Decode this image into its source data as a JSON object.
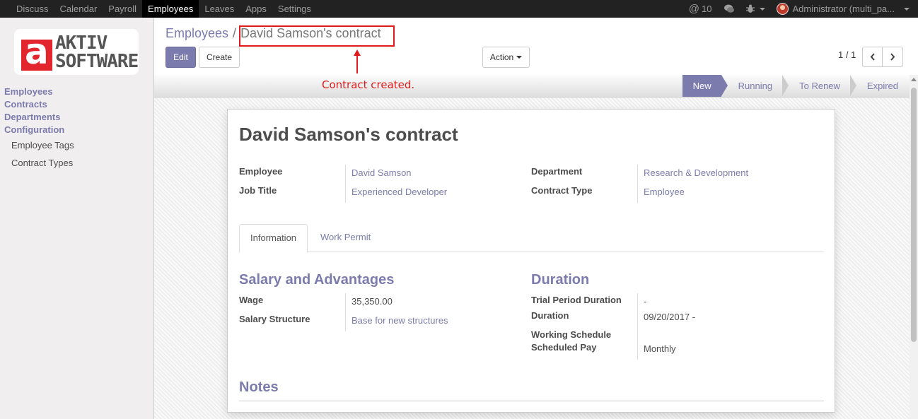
{
  "topbar": {
    "menu": [
      "Discuss",
      "Calendar",
      "Payroll",
      "Employees",
      "Leaves",
      "Apps",
      "Settings"
    ],
    "active_menu": "Employees",
    "mentions_symbol": "@",
    "mentions_count": "10",
    "user_name": "Administrator (multi_pa..."
  },
  "logo": {
    "line1": "AKTIV",
    "line2": "SOFTWARE",
    "letter": "a"
  },
  "sidebar": {
    "top_items": [
      "Employees",
      "Contracts",
      "Departments",
      "Configuration"
    ],
    "sub_items": [
      "Employee Tags",
      "Contract Types"
    ]
  },
  "control_panel": {
    "breadcrumb_parent": "Employees",
    "breadcrumb_sep": "/",
    "breadcrumb_current": "David Samson's contract",
    "edit_label": "Edit",
    "create_label": "Create",
    "action_label": "Action",
    "pager": "1 / 1"
  },
  "annotation": {
    "text": "Contract created.",
    "color": "#e01b1b"
  },
  "status": {
    "stages": [
      "New",
      "Running",
      "To Renew",
      "Expired"
    ],
    "active": "New"
  },
  "form": {
    "title": "David Samson's contract",
    "employee_label": "Employee",
    "employee_value": "David Samson",
    "job_title_label": "Job Title",
    "job_title_value": "Experienced Developer",
    "department_label": "Department",
    "department_value": "Research & Development",
    "contract_type_label": "Contract Type",
    "contract_type_value": "Employee",
    "tabs": [
      "Information",
      "Work Permit"
    ],
    "salary_section": "Salary and Advantages",
    "wage_label": "Wage",
    "wage_value": "35,350.00",
    "salary_structure_label": "Salary Structure",
    "salary_structure_value": "Base for new structures",
    "duration_section": "Duration",
    "trial_label": "Trial Period Duration",
    "trial_value": "-",
    "duration_label": "Duration",
    "duration_value": "09/20/2017 -",
    "working_schedule_label": "Working Schedule",
    "scheduled_pay_label": "Scheduled Pay",
    "scheduled_pay_value": "Monthly",
    "notes_section": "Notes"
  },
  "colors": {
    "brand": "#7c7bad",
    "navbar": "#222222",
    "annotation": "#e01b1b"
  }
}
